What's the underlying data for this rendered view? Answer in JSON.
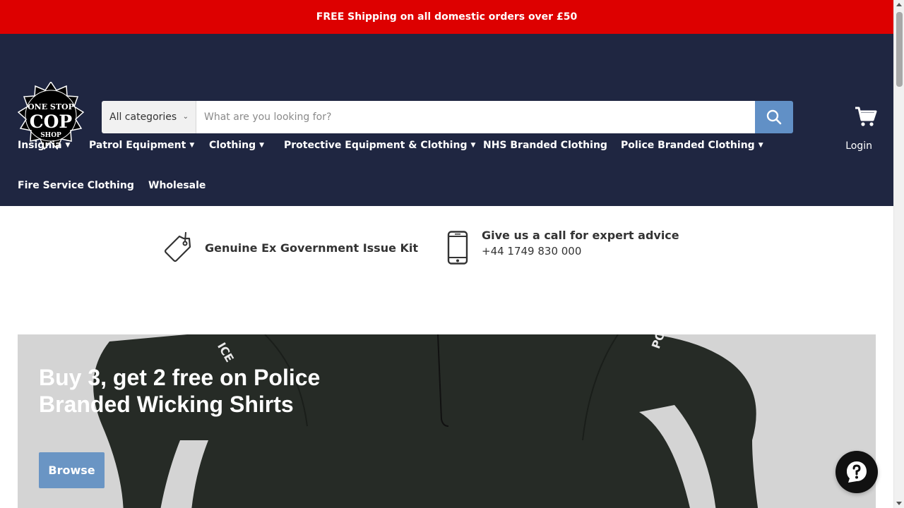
{
  "announcement": {
    "text": "FREE Shipping on all domestic orders over £50"
  },
  "logo": {
    "line1": "ONE STOP",
    "line2": "COP",
    "line3": "SHOP"
  },
  "search": {
    "category": "All categories",
    "placeholder": "What are you looking for?"
  },
  "nav": {
    "items": [
      {
        "label": "Insignia",
        "dropdown": true
      },
      {
        "label": "Patrol Equipment",
        "dropdown": true
      },
      {
        "label": "Clothing",
        "dropdown": true
      },
      {
        "label": "Protective Equipment & Clothing",
        "dropdown": true
      },
      {
        "label": "NHS Branded Clothing",
        "dropdown": false
      },
      {
        "label": "Police Branded Clothing",
        "dropdown": true
      },
      {
        "label": "Fire Service Clothing",
        "dropdown": false
      },
      {
        "label": "Wholesale",
        "dropdown": false
      }
    ],
    "login": "Login"
  },
  "features": {
    "kit": {
      "title": "Genuine Ex Government Issue Kit",
      "icon": "tag-icon"
    },
    "call": {
      "title": "Give us a call for expert advice",
      "phone": "+44 1749 830 000",
      "icon": "mobile-phone-icon"
    }
  },
  "hero": {
    "title": "Buy 3, get 2 free on Police Branded Wicking Shirts",
    "button": "Browse",
    "print_left": "ICE",
    "print_right": "PO"
  },
  "colors": {
    "announcement": "#dd0000",
    "header": "#1f2641",
    "accent": "#6190c6",
    "hero_bg": "#d4d4d4"
  }
}
